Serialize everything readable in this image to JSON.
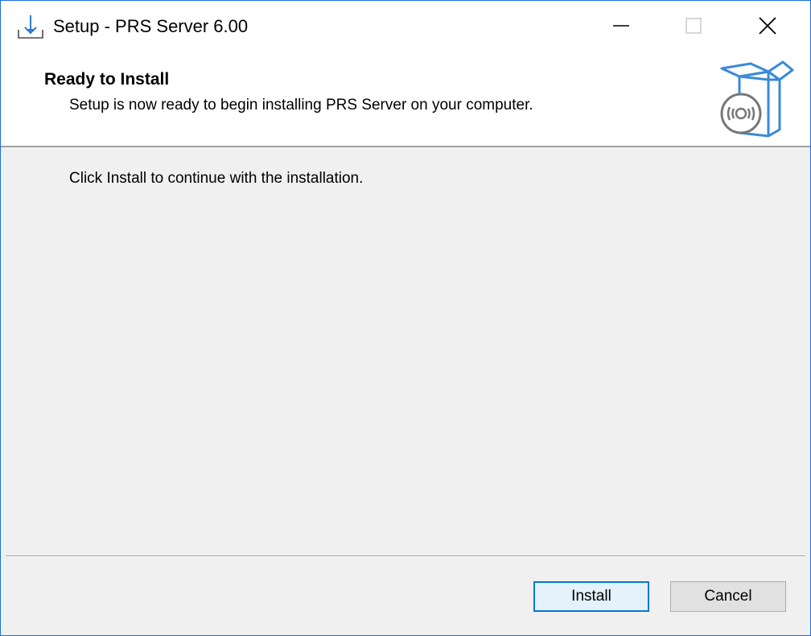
{
  "window": {
    "title": "Setup - PRS Server 6.00",
    "controls": {
      "minimize_icon": "minimize-icon",
      "maximize_icon": "maximize-icon",
      "close_icon": "close-icon"
    }
  },
  "header": {
    "title": "Ready to Install",
    "subtitle": "Setup is now ready to begin installing PRS Server on your computer.",
    "image_icon": "software-box-icon"
  },
  "body": {
    "instruction": "Click Install to continue with the installation."
  },
  "footer": {
    "install_label": "Install",
    "cancel_label": "Cancel"
  },
  "colors": {
    "accent": "#0078d7",
    "window_border": "#1a6fd6",
    "panel_bg": "#f0f0f0",
    "header_bg": "#ffffff"
  }
}
